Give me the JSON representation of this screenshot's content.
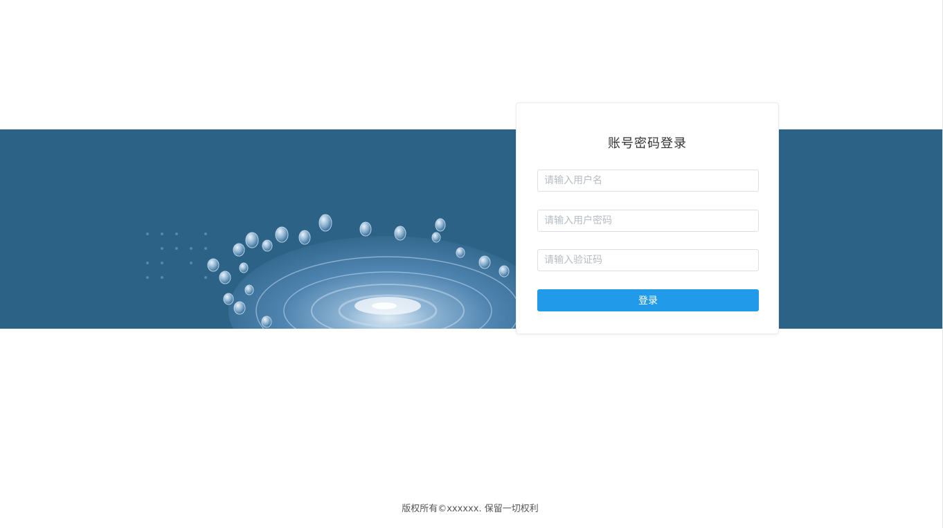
{
  "login": {
    "title": "账号密码登录",
    "username_placeholder": "请输入用户名",
    "password_placeholder": "请输入用户密码",
    "captcha_placeholder": "请输入验证码",
    "submit_label": "登录"
  },
  "footer": {
    "copyright": "版权所有©xxxxxx. 保留一切权利"
  },
  "colors": {
    "banner": "#2d6287",
    "button": "#219be9",
    "background": "#ffffff"
  }
}
